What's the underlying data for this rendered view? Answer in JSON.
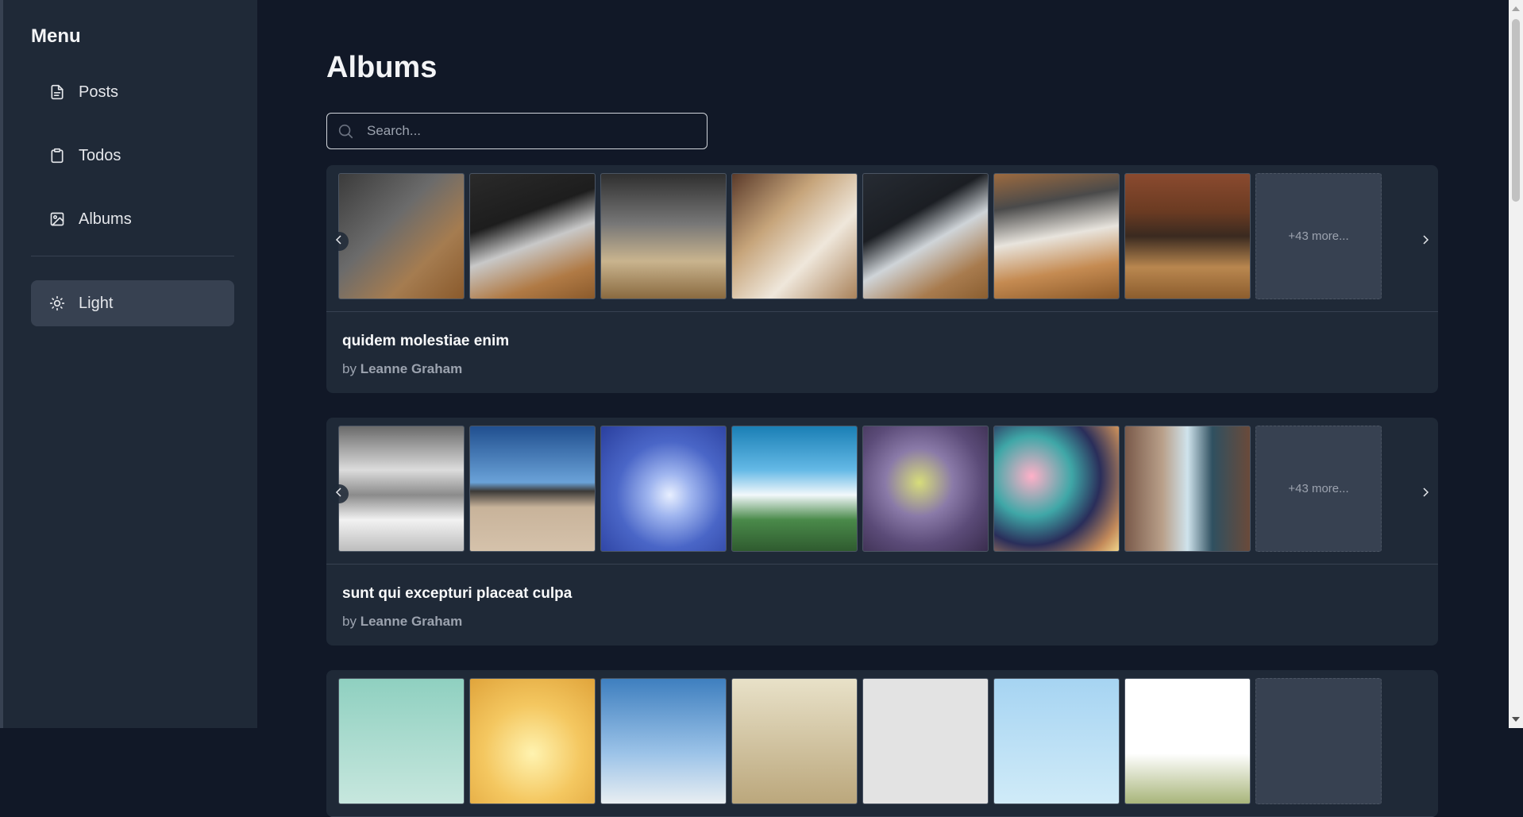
{
  "sidebar": {
    "title": "Menu",
    "items": [
      {
        "label": "Posts",
        "icon": "file-text-icon"
      },
      {
        "label": "Todos",
        "icon": "clipboard-icon"
      },
      {
        "label": "Albums",
        "icon": "image-icon"
      }
    ],
    "theme_toggle": {
      "label": "Light",
      "icon": "sun-icon"
    }
  },
  "main": {
    "title": "Albums",
    "search": {
      "placeholder": "Search...",
      "value": ""
    }
  },
  "albums": [
    {
      "title": "quidem molestiae enim",
      "by_prefix": "by",
      "author": "Leanne Graham",
      "more_label": "+43 more..."
    },
    {
      "title": "sunt qui excepturi placeat culpa",
      "by_prefix": "by",
      "author": "Leanne Graham",
      "more_label": "+43 more..."
    },
    {
      "title": "",
      "by_prefix": "",
      "author": "",
      "more_label": ""
    }
  ],
  "colors": {
    "background": "#111827",
    "sidebar": "#1f2937",
    "card": "#1f2937",
    "accent_button": "#374151",
    "text_primary": "#f9fafb",
    "text_muted": "#9ca3af"
  }
}
